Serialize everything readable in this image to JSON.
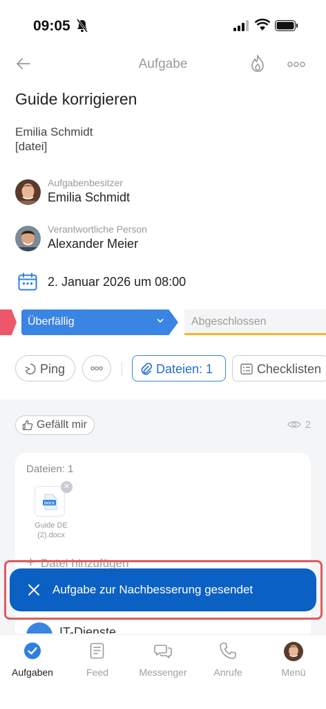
{
  "status": {
    "time": "09:05"
  },
  "nav": {
    "title": "Aufgabe"
  },
  "task": {
    "title": "Guide korrigieren",
    "description_line1": "Emilia Schmidt",
    "description_line2": "[datei]"
  },
  "owner": {
    "role": "Aufgabenbesitzer",
    "name": "Emilia Schmidt"
  },
  "responsible": {
    "role": "Verantwortliche Person",
    "name": "Alexander Meier"
  },
  "deadline": {
    "text": "2. Januar 2026 um 08:00"
  },
  "stages": {
    "active": "Überfällig",
    "next": "Abgeschlossen"
  },
  "actions": {
    "ping": "Ping",
    "files": "Dateien: 1",
    "checklists": "Checklisten"
  },
  "social": {
    "like": "Gefällt mir",
    "views": "2"
  },
  "files_card": {
    "title": "Dateien: 1",
    "file_name_line1": "Guide DE",
    "file_name_line2": "(2).docx",
    "file_badge": "DOCX",
    "add_file": "Datei hinzufügen"
  },
  "toast": {
    "text": "Aufgabe zur Nachbesserung gesendet"
  },
  "behind": {
    "text": "IT-Dienste"
  },
  "tabbar": {
    "tabs": [
      {
        "label": "Aufgaben"
      },
      {
        "label": "Feed"
      },
      {
        "label": "Messenger"
      },
      {
        "label": "Anrufe"
      },
      {
        "label": "Menü"
      }
    ]
  },
  "colors": {
    "accent": "#3a84e3",
    "toast": "#0b60c4",
    "overdue": "#f0566b",
    "stage_underline": "#f5b62a"
  }
}
